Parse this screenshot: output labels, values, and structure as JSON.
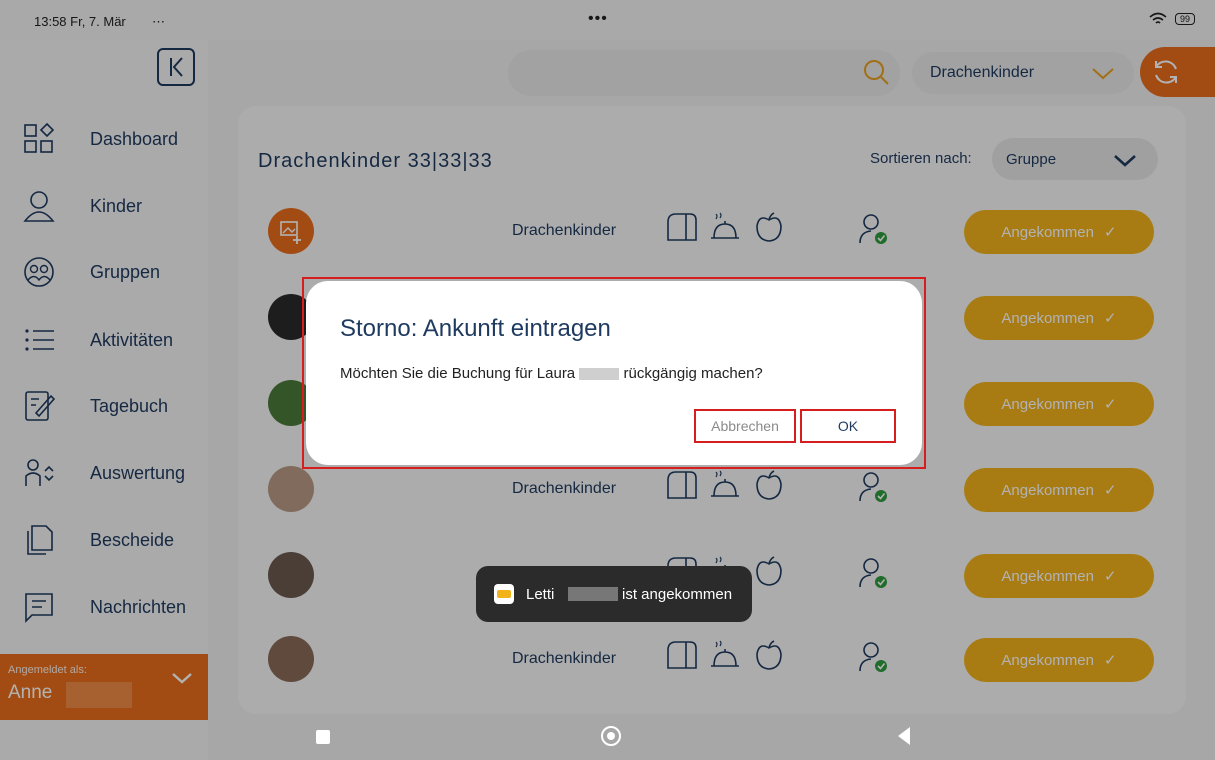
{
  "status_bar": {
    "time_date": "13:58  Fr, 7. Mär",
    "extra": "⋯",
    "center_dots": "•••",
    "battery": "99"
  },
  "sidebar": {
    "items": [
      {
        "label": "Dashboard",
        "icon": "dashboard-icon"
      },
      {
        "label": "Kinder",
        "icon": "person-icon"
      },
      {
        "label": "Gruppen",
        "icon": "group-icon"
      },
      {
        "label": "Aktivitäten",
        "icon": "list-icon"
      },
      {
        "label": "Tagebuch",
        "icon": "diary-icon"
      },
      {
        "label": "Auswertung",
        "icon": "analysis-icon"
      },
      {
        "label": "Bescheide",
        "icon": "documents-icon"
      },
      {
        "label": "Nachrichten",
        "icon": "messages-icon"
      }
    ],
    "login_caption": "Angemeldet als:",
    "login_name": "Anne"
  },
  "topbar": {
    "search_placeholder": "",
    "group_selected": "Drachenkinder"
  },
  "list": {
    "title": "Drachenkinder 33|33|33",
    "sort_label": "Sortieren nach:",
    "sort_value": "Gruppe",
    "rows": [
      {
        "group": "Drachenkinder",
        "button": "Angekommen"
      },
      {
        "group": "",
        "button": "Angekommen"
      },
      {
        "group": "",
        "button": "Angekommen"
      },
      {
        "group": "Drachenkinder",
        "button": "Angekommen"
      },
      {
        "group": "",
        "button": "Angekommen"
      },
      {
        "group": "Drachenkinder",
        "button": "Angekommen"
      }
    ]
  },
  "dialog": {
    "title": "Storno: Ankunft eintragen",
    "message_pre": "Möchten Sie die Buchung für Laura",
    "message_post": "rückgängig machen?",
    "cancel_label": "Abbrechen",
    "ok_label": "OK"
  },
  "toast": {
    "text_pre": "Letti",
    "text_post": "ist angekommen"
  },
  "colors": {
    "accent_orange": "#e86e1c",
    "button_yellow": "#f1b21a",
    "text_navy": "#1f3a5f",
    "highlight_red": "#d61e1e"
  }
}
